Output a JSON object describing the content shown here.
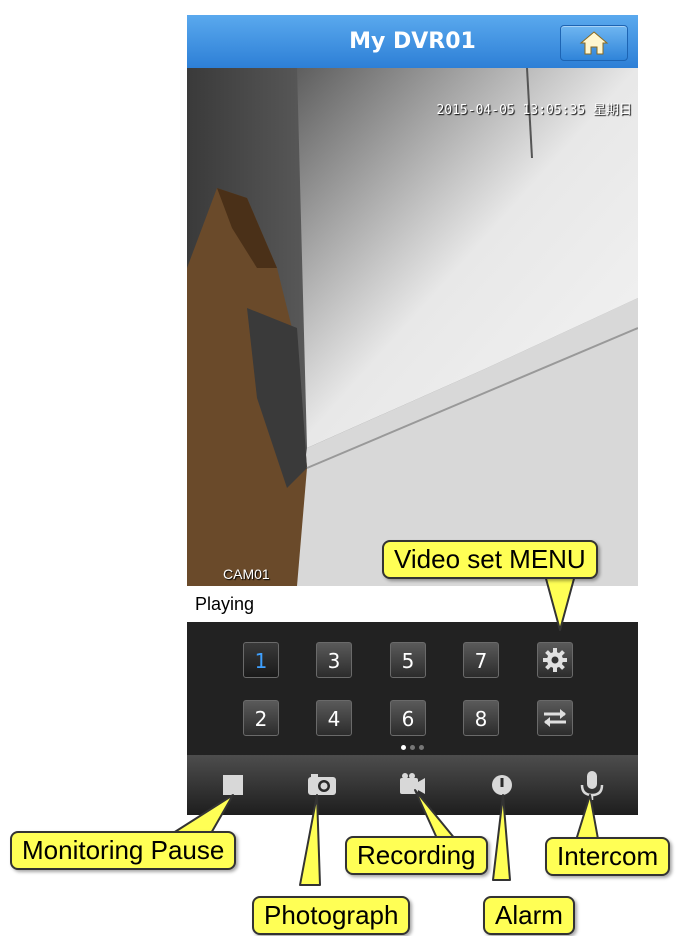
{
  "app": {
    "title": "My DVR01",
    "home_icon": "home-icon"
  },
  "video": {
    "timestamp": "2015-04-05 13:05:35 星期日",
    "camera_label": "CAM01"
  },
  "status_text": "Playing",
  "channels": {
    "row1": [
      "1",
      "3",
      "5",
      "7"
    ],
    "row2": [
      "2",
      "4",
      "6",
      "8"
    ],
    "active": "1",
    "settings_icon": "gear-icon",
    "switch_icon": "swap-arrows-icon",
    "page_dots": 3,
    "active_dot": 0
  },
  "toolbar": {
    "items": [
      {
        "name": "stop",
        "icon": "stop-icon"
      },
      {
        "name": "photograph",
        "icon": "camera-icon"
      },
      {
        "name": "recording",
        "icon": "video-camera-icon"
      },
      {
        "name": "alarm",
        "icon": "alarm-icon"
      },
      {
        "name": "intercom",
        "icon": "microphone-icon"
      }
    ]
  },
  "callouts": {
    "video_set_menu": "Video set MENU",
    "monitoring_pause": "Monitoring Pause",
    "photograph": "Photograph",
    "recording": "Recording",
    "alarm": "Alarm",
    "intercom": "Intercom"
  },
  "colors": {
    "titlebar": "#3a8fe0",
    "callout": "#ffff55",
    "active_channel": "#3ea0ff"
  }
}
